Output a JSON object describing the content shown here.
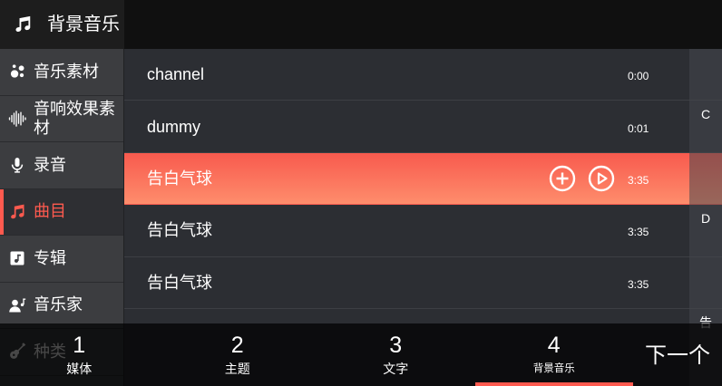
{
  "header": {
    "title": "背景音乐",
    "icon": "music-note-icon"
  },
  "sidebar": {
    "items": [
      {
        "label": "音乐素材",
        "icon": "bubbles-icon"
      },
      {
        "label": "音响效果素材",
        "icon": "waveform-icon"
      },
      {
        "label": "录音",
        "icon": "microphone-icon"
      },
      {
        "label": "曲目",
        "icon": "music-note-icon",
        "active": true
      },
      {
        "label": "专辑",
        "icon": "album-icon"
      },
      {
        "label": "音乐家",
        "icon": "artist-icon"
      },
      {
        "label": "种类",
        "icon": "guitar-icon"
      }
    ]
  },
  "tracks": [
    {
      "title": "channel",
      "duration": "0:00"
    },
    {
      "title": "dummy",
      "duration": "0:01"
    },
    {
      "title": "告白气球",
      "duration": "3:35",
      "selected": true,
      "actions": [
        "add-circle-icon",
        "play-circle-icon"
      ]
    },
    {
      "title": "告白气球",
      "duration": "3:35"
    },
    {
      "title": "告白气球",
      "duration": "3:35"
    }
  ],
  "index": [
    "C",
    "D",
    "告"
  ],
  "tabs": [
    {
      "number": "1",
      "label": "媒体"
    },
    {
      "number": "2",
      "label": "主题"
    },
    {
      "number": "3",
      "label": "文字"
    },
    {
      "number": "4",
      "label": "背景音乐",
      "active": true
    }
  ],
  "next_button": {
    "label": "下一个"
  },
  "colors": {
    "accent": "#ff5a4f",
    "selected_row_top": "#f85a4e",
    "selected_row_bottom": "#fe8d6c",
    "header_bg": "#1d1d1d",
    "topbar_bg": "#101010",
    "sidebar_bg": "#3c3d40",
    "sidebar_active_bg": "#2e2f33",
    "list_bg": "#2c2e33",
    "divider": "#3d3f44",
    "text": "#ffffff"
  }
}
